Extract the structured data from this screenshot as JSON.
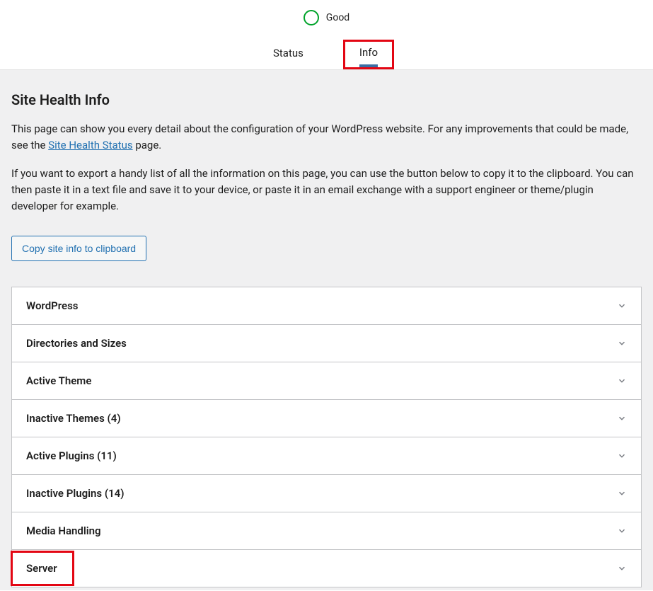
{
  "header": {
    "status_label": "Good",
    "tabs": {
      "status": "Status",
      "info": "Info"
    }
  },
  "page": {
    "title": "Site Health Info",
    "description1_pre": "This page can show you every detail about the configuration of your WordPress website. For any improvements that could be made, see the ",
    "description1_link": "Site Health Status",
    "description1_post": " page.",
    "description2": "If you want to export a handy list of all the information on this page, you can use the button below to copy it to the clipboard. You can then paste it in a text file and save it to your device, or paste it in an email exchange with a support engineer or theme/plugin developer for example.",
    "copy_button": "Copy site info to clipboard"
  },
  "accordion": {
    "items": [
      {
        "label": "WordPress"
      },
      {
        "label": "Directories and Sizes"
      },
      {
        "label": "Active Theme"
      },
      {
        "label": "Inactive Themes (4)"
      },
      {
        "label": "Active Plugins (11)"
      },
      {
        "label": "Inactive Plugins (14)"
      },
      {
        "label": "Media Handling"
      },
      {
        "label": "Server"
      }
    ]
  }
}
